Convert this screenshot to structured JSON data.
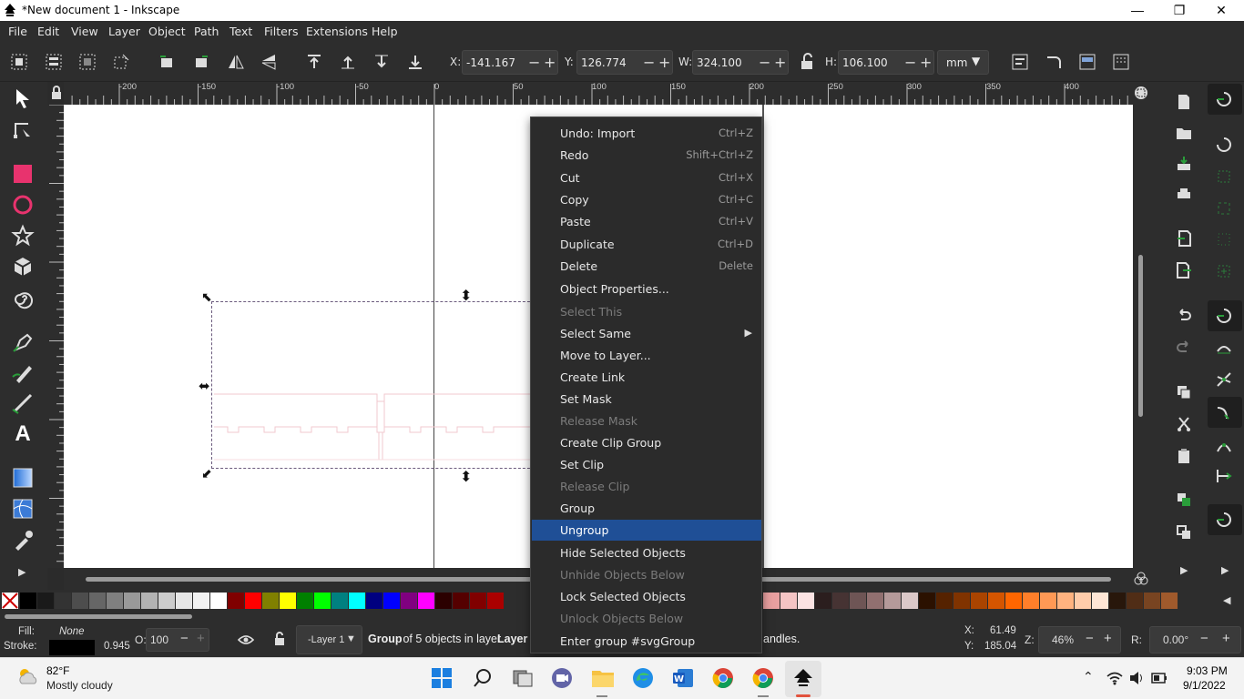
{
  "window": {
    "title": "*New document 1 - Inkscape",
    "controls": [
      "minimize",
      "restore",
      "close"
    ]
  },
  "menubar": [
    "File",
    "Edit",
    "View",
    "Layer",
    "Object",
    "Path",
    "Text",
    "Filters",
    "Extensions",
    "Help"
  ],
  "toolbar": {
    "x_label": "X:",
    "x_value": "-141.167",
    "y_label": "Y:",
    "y_value": "126.774",
    "w_label": "W:",
    "w_value": "324.100",
    "h_label": "H:",
    "h_value": "106.100",
    "unit": "mm"
  },
  "ruler": {
    "ticks": [
      "-200",
      "-150",
      "-100",
      "-50",
      "0",
      "50",
      "100",
      "150",
      "200",
      "250",
      "300",
      "350",
      "400"
    ]
  },
  "context_menu": [
    {
      "label": "Undo: Import",
      "shortcut": "Ctrl+Z",
      "disabled": false
    },
    {
      "label": "Redo",
      "shortcut": "Shift+Ctrl+Z",
      "disabled": false
    },
    {
      "label": "Cut",
      "shortcut": "Ctrl+X",
      "disabled": false
    },
    {
      "label": "Copy",
      "shortcut": "Ctrl+C",
      "disabled": false
    },
    {
      "label": "Paste",
      "shortcut": "Ctrl+V",
      "disabled": false
    },
    {
      "label": "Duplicate",
      "shortcut": "Ctrl+D",
      "disabled": false
    },
    {
      "label": "Delete",
      "shortcut": "Delete",
      "disabled": false
    },
    {
      "label": "Object Properties...",
      "shortcut": "",
      "disabled": false
    },
    {
      "label": "Select This",
      "shortcut": "",
      "disabled": true
    },
    {
      "label": "Select Same",
      "shortcut": "",
      "disabled": false,
      "submenu": true
    },
    {
      "label": "Move to Layer...",
      "shortcut": "",
      "disabled": false
    },
    {
      "label": "Create Link",
      "shortcut": "",
      "disabled": false
    },
    {
      "label": "Set Mask",
      "shortcut": "",
      "disabled": false
    },
    {
      "label": "Release Mask",
      "shortcut": "",
      "disabled": true
    },
    {
      "label": "Create Clip Group",
      "shortcut": "",
      "disabled": false
    },
    {
      "label": "Set Clip",
      "shortcut": "",
      "disabled": false
    },
    {
      "label": "Release Clip",
      "shortcut": "",
      "disabled": true
    },
    {
      "label": "Group",
      "shortcut": "",
      "disabled": false
    },
    {
      "label": "Ungroup",
      "shortcut": "",
      "disabled": false,
      "selected": true
    },
    {
      "label": "Hide Selected Objects",
      "shortcut": "",
      "disabled": false
    },
    {
      "label": "Unhide Objects Below",
      "shortcut": "",
      "disabled": true
    },
    {
      "label": "Lock Selected Objects",
      "shortcut": "",
      "disabled": false
    },
    {
      "label": "Unlock Objects Below",
      "shortcut": "",
      "disabled": true
    },
    {
      "label": "Enter group #svgGroup",
      "shortcut": "",
      "disabled": false
    }
  ],
  "status": {
    "fill_label": "Fill:",
    "fill_value": "None",
    "stroke_label": "Stroke:",
    "stroke_width": "0.945",
    "opacity_label": "O:",
    "opacity_value": "100",
    "layer": "-Layer 1",
    "message_bold": "Group",
    "message": " of 5 objects in layer ",
    "message_layer": "Layer",
    "message_tail": "andles.",
    "cursor_x_label": "X:",
    "cursor_x": "61.49",
    "cursor_y_label": "Y:",
    "cursor_y": "185.04",
    "zoom_label": "Z:",
    "zoom": "46%",
    "rotate_label": "R:",
    "rotate": "0.00°"
  },
  "taskbar": {
    "weather_temp": "82°F",
    "weather_desc": "Mostly cloudy",
    "time": "9:03 PM",
    "date": "9/1/2022"
  },
  "palette_colors": [
    "#000000",
    "#1a1a1a",
    "#333333",
    "#4d4d4d",
    "#666666",
    "#808080",
    "#999999",
    "#b3b3b3",
    "#cccccc",
    "#e6e6e6",
    "#f2f2f2",
    "#ffffff",
    "#800000",
    "#ff0000",
    "#808000",
    "#ffff00",
    "#008000",
    "#00ff00",
    "#008080",
    "#00ffff",
    "#000080",
    "#0000ff",
    "#800080",
    "#ff00ff",
    "#2b0000",
    "#550000",
    "#800000",
    "#aa0000"
  ],
  "palette_colors_right": [
    "#e9a0a0",
    "#f4c4c4",
    "#fbe2e2",
    "#2b1e1e",
    "#463333",
    "#6e5555",
    "#917070",
    "#b59a9a",
    "#dbc8c8",
    "#2b1100",
    "#552200",
    "#803300",
    "#aa4400",
    "#d45500",
    "#ff6600",
    "#ff7f2a",
    "#ff9955",
    "#ffb380",
    "#ffccaa",
    "#ffe6d5",
    "#28170b",
    "#502d16",
    "#784421",
    "#a05a2c"
  ]
}
